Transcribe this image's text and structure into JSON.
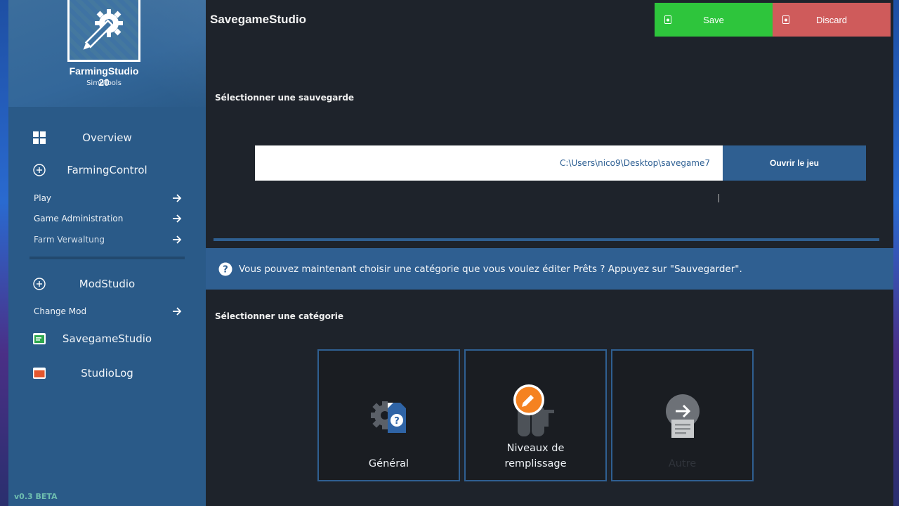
{
  "app": {
    "name": "FarmingStudio 20",
    "subtitle": "SimuTools",
    "version": "v0.3 BETA"
  },
  "sidebar": {
    "overview": "Overview",
    "farming_control": "FarmingControl",
    "farming_items": [
      "Play",
      "Game Administration",
      "Farm Verwaltung"
    ],
    "mod_studio": "ModStudio",
    "mod_items": [
      "Change Mod"
    ],
    "savegame_studio": "SavegameStudio",
    "studio_log": "StudioLog",
    "log_badge": "LOG"
  },
  "header": {
    "title": "SavegameStudio",
    "save_label": "Save",
    "discard_label": "Discard"
  },
  "savegame": {
    "section_title": "Sélectionner une sauvegarde",
    "path": "C:\\Users\\nico9\\Desktop\\savegame7",
    "open_label": "Ouvrir le jeu"
  },
  "info": {
    "text": "Vous pouvez maintenant choisir une catégorie que vous voulez éditer Prêts ? Appuyez sur \"Sauvegarder\"."
  },
  "categories": {
    "section_title": "Sélectionner une catégorie",
    "items": [
      {
        "label": "Général",
        "enabled": true
      },
      {
        "label_line1": "Niveaux de",
        "label_line2": "remplissage",
        "enabled": true
      },
      {
        "label": "Autre",
        "enabled": false
      }
    ]
  },
  "colors": {
    "accent": "#2f5f91",
    "save": "#2ec53c",
    "discard": "#cf5b5b",
    "edit_badge": "#f58220"
  }
}
